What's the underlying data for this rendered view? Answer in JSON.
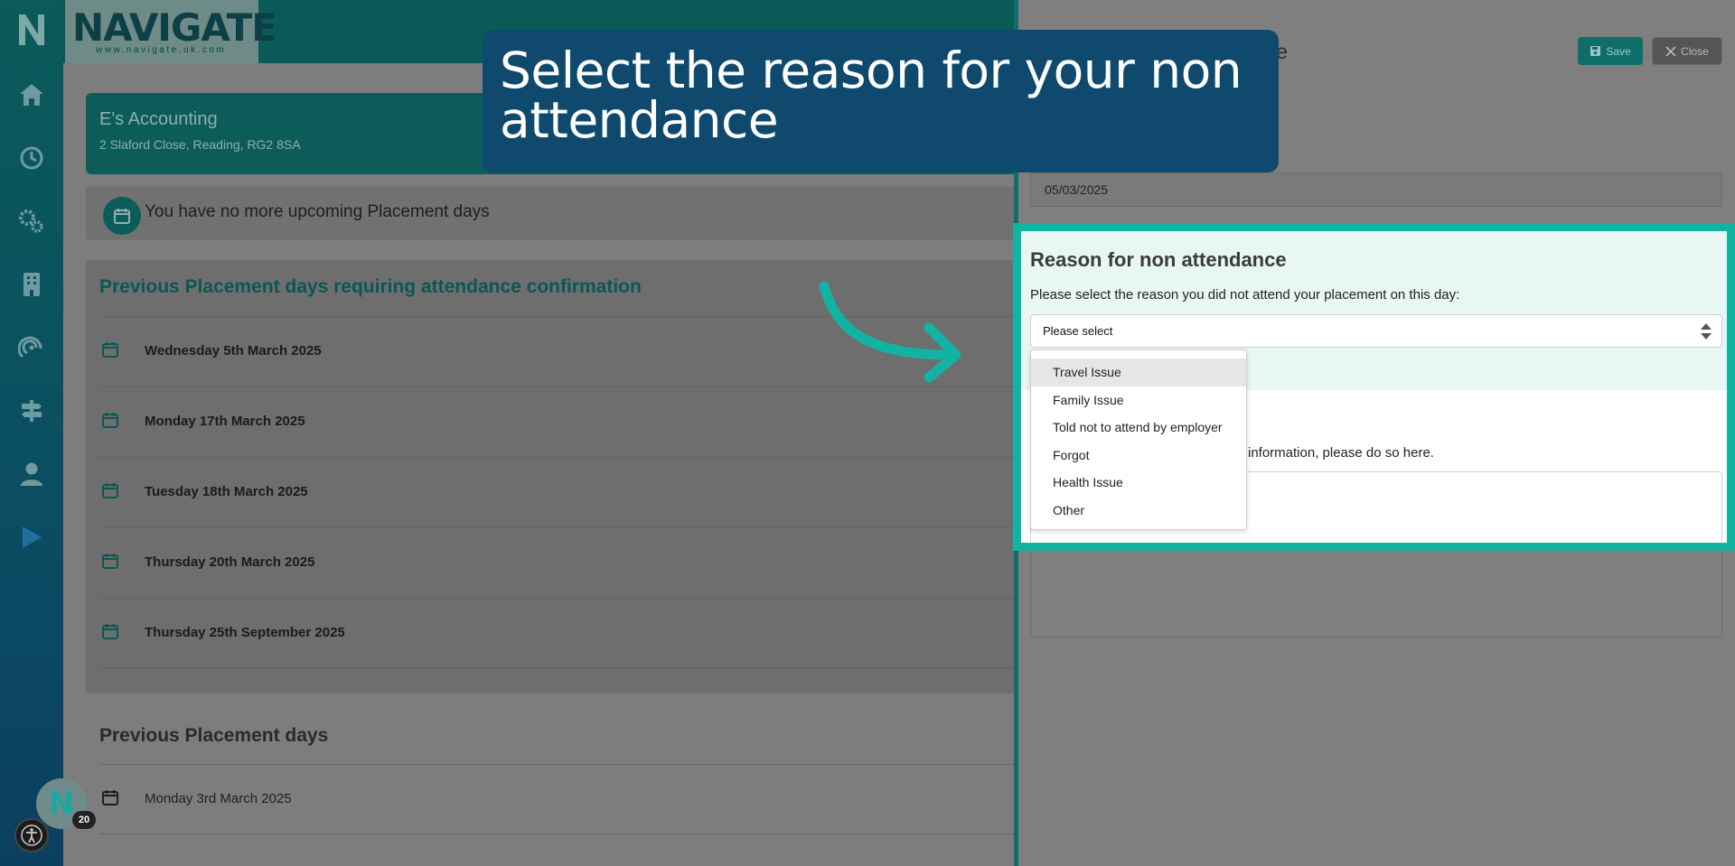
{
  "brand": {
    "logo_text": "NAVIGATE",
    "logo_url": "www.navigate.uk.com"
  },
  "sidebar": {
    "icons": [
      "home-icon",
      "clock-icon",
      "cogs-icon",
      "building-icon",
      "headset-icon",
      "signpost-icon",
      "user-icon",
      "play-icon"
    ],
    "notification_count": "20"
  },
  "company": {
    "name": "E's Accounting",
    "address": "2 Slaford Close, Reading, RG2 8SA"
  },
  "upcoming": {
    "text": "You have no more upcoming Placement days"
  },
  "previous_requiring": {
    "title": "Previous Placement days requiring attendance confirmation",
    "days": [
      "Wednesday 5th March 2025",
      "Monday 17th March 2025",
      "Tuesday 18th March 2025",
      "Thursday 20th March 2025",
      "Thursday 25th September 2025"
    ]
  },
  "previous_days": {
    "title": "Previous Placement days",
    "days": [
      "Monday 3rd March 2025"
    ]
  },
  "panel": {
    "title_visible": "ance",
    "save_label": "Save",
    "close_label": "Close",
    "date_value": "05/03/2025",
    "reason_title": "Reason for non attendance",
    "reason_desc": "Please select the reason you did not attend your placement on this day:",
    "select_value": "Please select",
    "extra_desc_visible": "information, please do so here.",
    "options": [
      "Travel Issue",
      "Family Issue",
      "Told not to attend by employer",
      "Forgot",
      "Health Issue",
      "Other"
    ],
    "highlighted_option": "Travel Issue"
  },
  "callout": {
    "text": "Select the reason for your non attendance"
  },
  "colors": {
    "accent": "#12b3a3",
    "callout_bg": "#0f4a6e",
    "brand_dark": "#0a5a58"
  }
}
